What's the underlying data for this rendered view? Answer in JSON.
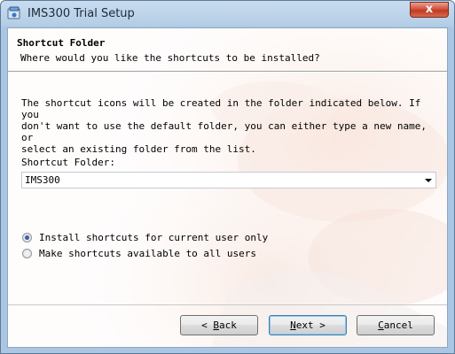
{
  "window": {
    "title": "IMS300 Trial Setup",
    "close_label": "x"
  },
  "header": {
    "title": "Shortcut Folder",
    "subtitle": "Where would you like the shortcuts to be installed?"
  },
  "body": {
    "description": "The shortcut icons will be created in the folder indicated below. If you\ndon't want to use the default folder, you can either type a new name, or\nselect an existing folder from the list."
  },
  "shortcut_folder": {
    "label": "Shortcut Folder:",
    "value": "IMS300"
  },
  "options": [
    {
      "label": "Install shortcuts for current user only",
      "selected": true
    },
    {
      "label": "Make shortcuts available to all users",
      "selected": false
    }
  ],
  "buttons": {
    "back": {
      "pre": "< ",
      "accel": "B",
      "rest": "ack"
    },
    "next": {
      "accel": "N",
      "rest": "ext",
      "post": " >"
    },
    "cancel": {
      "accel": "C",
      "rest": "ancel"
    }
  },
  "colors": {
    "title_bar": "#b4cde6",
    "close_button": "#c13a22",
    "accent_default_button": "#3c7fb1"
  },
  "icons": {
    "app": "setup-icon",
    "close": "close-icon",
    "dropdown": "chevron-down-icon"
  }
}
